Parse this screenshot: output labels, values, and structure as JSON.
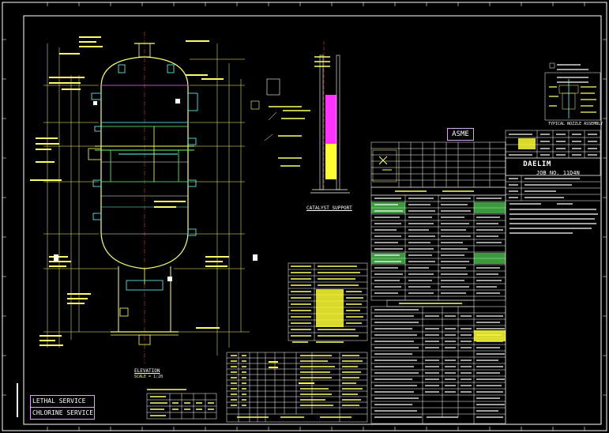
{
  "drawing": {
    "lethal_service": "LETHAL SERVICE",
    "chlorine_service": "CHLORINE SERVICE",
    "asme": "ASME",
    "logo": "DAELIM",
    "job_no": "JOB NO. 11D4N",
    "catalyst_support": "CATALYST SUPPORT",
    "elevation": "ELEVATION",
    "scale": "SCALE = 1:20",
    "typical_nozzle": "TYPICAL NOZZLE ASSEMBLY"
  },
  "colors": {
    "background": "#000000",
    "border": "#ffffff",
    "vessel_yellow": "#ffff66",
    "vessel_green": "#66ff66",
    "vessel_cyan": "#66ffff",
    "magenta": "#ff33ff",
    "table_green": "#33ff33"
  }
}
